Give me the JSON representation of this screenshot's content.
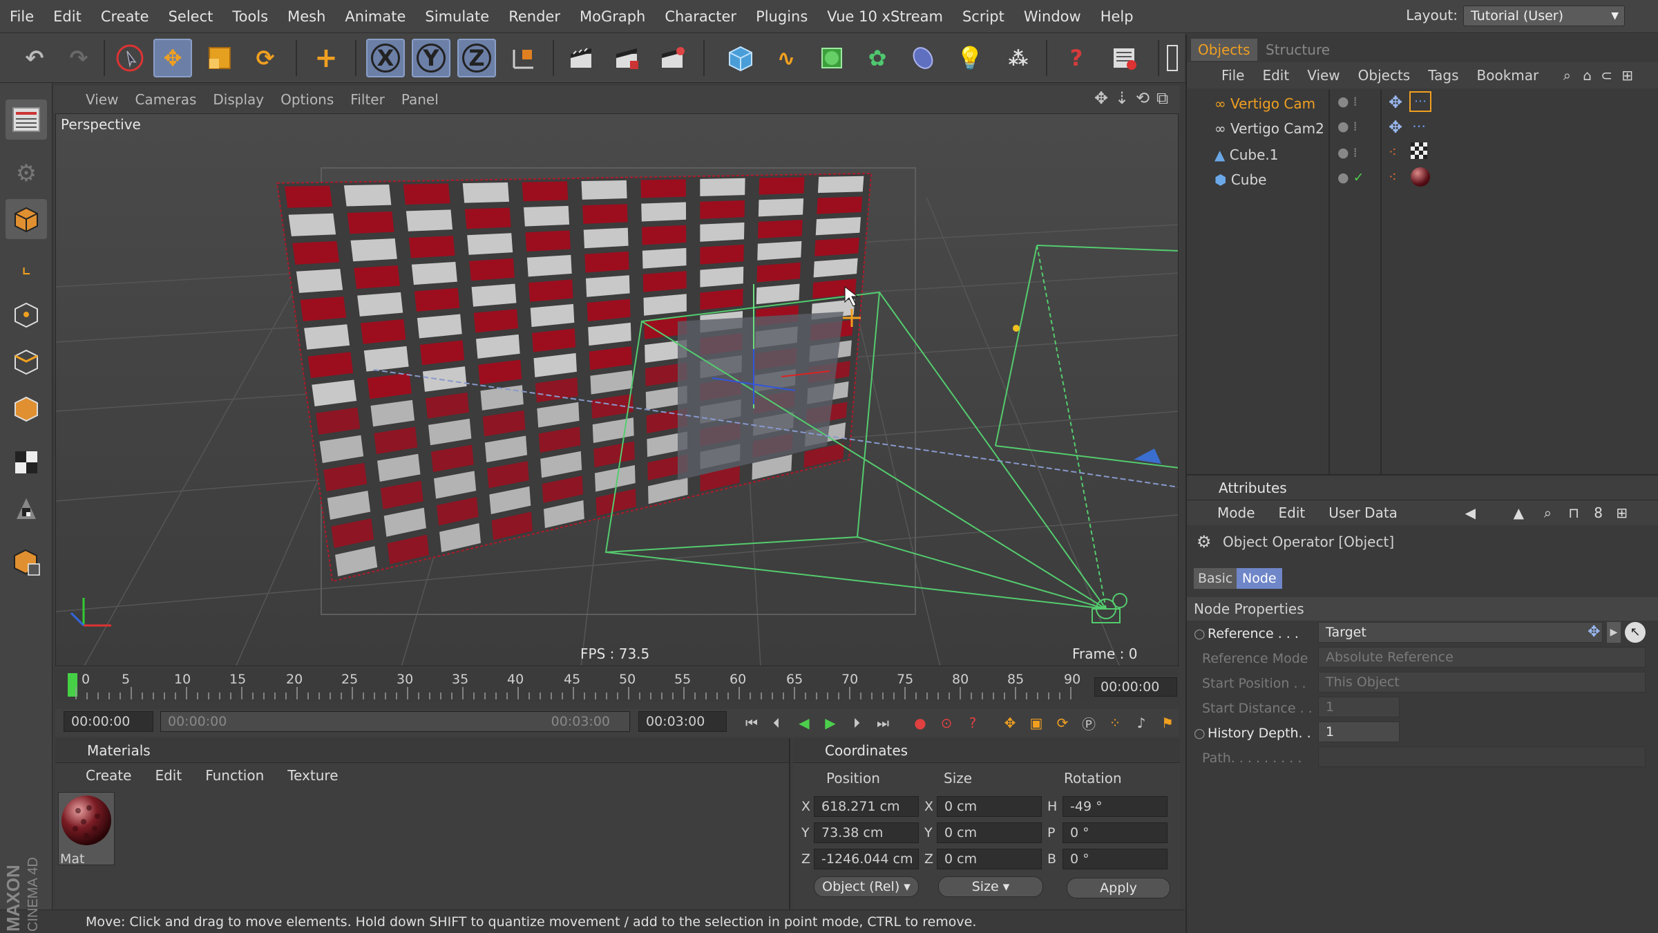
{
  "menubar": {
    "items": [
      "File",
      "Edit",
      "Create",
      "Select",
      "Tools",
      "Mesh",
      "Animate",
      "Simulate",
      "Render",
      "MoGraph",
      "Character",
      "Plugins",
      "Vue 10 xStream",
      "Script",
      "Window",
      "Help"
    ],
    "layout_label": "Layout:",
    "layout_value": "Tutorial (User)"
  },
  "toolbar": {
    "axis_x": "X",
    "axis_y": "Y",
    "axis_z": "Z"
  },
  "viewport": {
    "menu": [
      "View",
      "Cameras",
      "Display",
      "Options",
      "Filter",
      "Panel"
    ],
    "label": "Perspective",
    "fps": "FPS : 73.5",
    "frame": "Frame : 0"
  },
  "timeline": {
    "ticks": [
      "0",
      "5",
      "10",
      "15",
      "20",
      "25",
      "30",
      "35",
      "40",
      "45",
      "50",
      "55",
      "60",
      "65",
      "70",
      "75",
      "80",
      "85",
      "90"
    ],
    "current": "00:00:00",
    "start": "00:00:00",
    "range_start": "00:00:00",
    "range_end": "00:03:00",
    "end": "00:03:00"
  },
  "materials": {
    "title": "Materials",
    "menu": [
      "Create",
      "Edit",
      "Function",
      "Texture"
    ],
    "mat_label": "Mat"
  },
  "coordinates": {
    "title": "Coordinates",
    "col_position": "Position",
    "col_size": "Size",
    "col_rotation": "Rotation",
    "rows": [
      {
        "axis": "X",
        "pos": "618.271 cm",
        "size_axis": "X",
        "size": "0 cm",
        "rot_axis": "H",
        "rot": "-49 °"
      },
      {
        "axis": "Y",
        "pos": "73.38 cm",
        "size_axis": "Y",
        "size": "0 cm",
        "rot_axis": "P",
        "rot": "0 °"
      },
      {
        "axis": "Z",
        "pos": "-1246.044 cm",
        "size_axis": "Z",
        "size": "0 cm",
        "rot_axis": "B",
        "rot": "0 °"
      }
    ],
    "mode_select": "Object (Rel)",
    "size_select": "Size",
    "apply": "Apply"
  },
  "objects": {
    "tab_objects": "Objects",
    "tab_structure": "Structure",
    "menu": [
      "File",
      "Edit",
      "View",
      "Objects",
      "Tags",
      "Bookmar"
    ],
    "rows": [
      "Vertigo Cam",
      "Vertigo Cam2",
      "Cube.1",
      "Cube"
    ]
  },
  "attributes": {
    "title": "Attributes",
    "menu": [
      "Mode",
      "Edit",
      "User Data"
    ],
    "object_title": "Object Operator [Object]",
    "tab_basic": "Basic",
    "tab_node": "Node",
    "section": "Node Properties",
    "reference_label": "Reference . . .",
    "reference_value": "Target",
    "ref_mode_label": "Reference Mode",
    "ref_mode_value": "Absolute Reference",
    "start_pos_label": "Start Position . .",
    "start_pos_value": "This Object",
    "start_dist_label": "Start Distance . .",
    "start_dist_value": "1",
    "history_label": "History Depth. .",
    "history_value": "1",
    "path_label": "Path. . . . . . . . ."
  },
  "statusbar": {
    "text": "Move: Click and drag to move elements. Hold down SHIFT to quantize movement / add to the selection in point mode, CTRL to remove."
  },
  "branding": {
    "maxon": "MAXON",
    "c4d": "CINEMA 4D"
  },
  "colors": {
    "accent_orange": "#f0a020",
    "selection_blue": "#6c7fa6",
    "camera_green": "#52d070",
    "checker_red": "#9c0e1e"
  }
}
